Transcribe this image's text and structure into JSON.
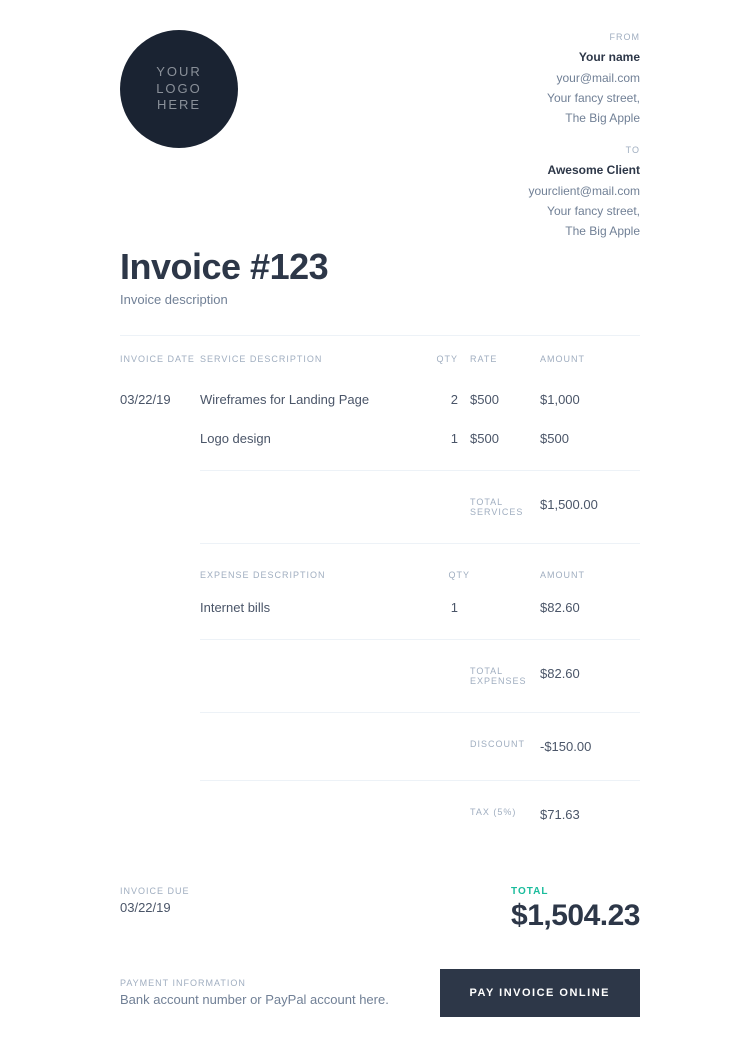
{
  "logo": {
    "line1": "YOUR",
    "line2": "LOGO",
    "line3": "HERE"
  },
  "from": {
    "label": "FROM",
    "name": "Your name",
    "email": "your@mail.com",
    "street": "Your fancy street,",
    "city": "The Big Apple"
  },
  "to": {
    "label": "TO",
    "name": "Awesome Client",
    "email": "yourclient@mail.com",
    "street": "Your fancy street,",
    "city": "The Big Apple"
  },
  "invoice": {
    "title": "Invoice #123",
    "description": "Invoice description"
  },
  "headers": {
    "date": "INVOICE DATE",
    "service": "SERVICE DESCRIPTION",
    "qty": "QTY",
    "rate": "RATE",
    "amount": "AMOUNT",
    "expense": "EXPENSE DESCRIPTION"
  },
  "date": "03/22/19",
  "services": [
    {
      "desc": "Wireframes for Landing Page",
      "qty": "2",
      "rate": "$500",
      "amount": "$1,000"
    },
    {
      "desc": "Logo design",
      "qty": "1",
      "rate": "$500",
      "amount": "$500"
    }
  ],
  "expenses": [
    {
      "desc": "Internet bills",
      "qty": "1",
      "amount": "$82.60"
    }
  ],
  "summary": {
    "total_services_label": "TOTAL SERVICES",
    "total_services": "$1,500.00",
    "total_expenses_label": "TOTAL EXPENSES",
    "total_expenses": "$82.60",
    "discount_label": "DISCOUNT",
    "discount": "-$150.00",
    "tax_label": "TAX (5%)",
    "tax": "$71.63"
  },
  "due": {
    "label": "INVOICE DUE",
    "date": "03/22/19"
  },
  "total": {
    "label": "TOTAL",
    "value": "$1,504.23"
  },
  "payment": {
    "label": "PAYMENT INFORMATION",
    "info": "Bank account number or PayPal account here.",
    "button": "PAY INVOICE ONLINE"
  }
}
